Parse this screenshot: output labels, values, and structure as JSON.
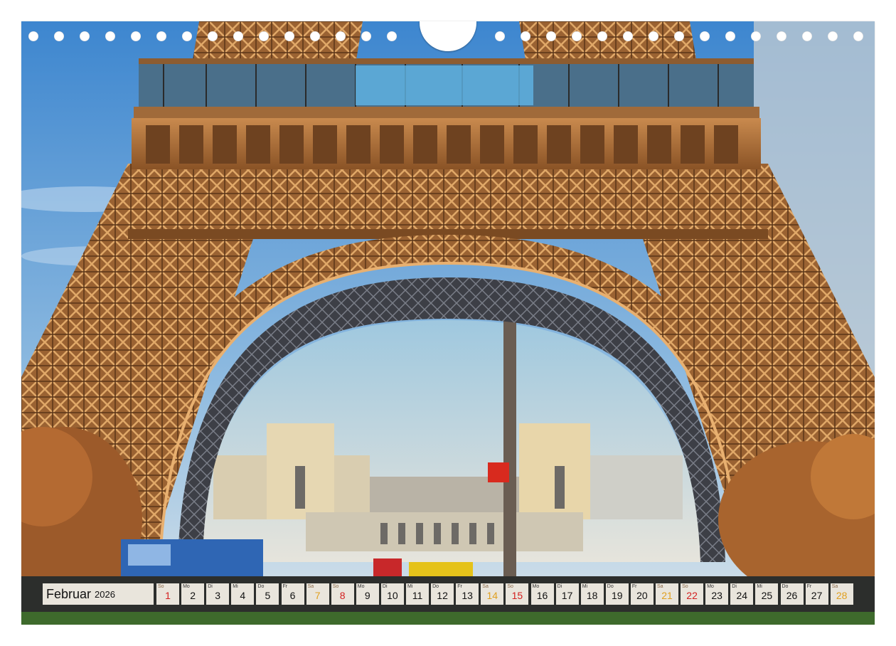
{
  "calendar": {
    "month": "Februar",
    "year": "2026",
    "days": [
      {
        "dow": "So",
        "num": "1",
        "type": "sun"
      },
      {
        "dow": "Mo",
        "num": "2",
        "type": "wd"
      },
      {
        "dow": "Di",
        "num": "3",
        "type": "wd"
      },
      {
        "dow": "Mi",
        "num": "4",
        "type": "wd"
      },
      {
        "dow": "Do",
        "num": "5",
        "type": "wd"
      },
      {
        "dow": "Fr",
        "num": "6",
        "type": "wd"
      },
      {
        "dow": "Sa",
        "num": "7",
        "type": "sat"
      },
      {
        "dow": "So",
        "num": "8",
        "type": "sun"
      },
      {
        "dow": "Mo",
        "num": "9",
        "type": "wd"
      },
      {
        "dow": "Di",
        "num": "10",
        "type": "wd"
      },
      {
        "dow": "Mi",
        "num": "11",
        "type": "wd"
      },
      {
        "dow": "Do",
        "num": "12",
        "type": "wd"
      },
      {
        "dow": "Fr",
        "num": "13",
        "type": "wd"
      },
      {
        "dow": "Sa",
        "num": "14",
        "type": "sat"
      },
      {
        "dow": "So",
        "num": "15",
        "type": "sun"
      },
      {
        "dow": "Mo",
        "num": "16",
        "type": "wd"
      },
      {
        "dow": "Di",
        "num": "17",
        "type": "wd"
      },
      {
        "dow": "Mi",
        "num": "18",
        "type": "wd"
      },
      {
        "dow": "Do",
        "num": "19",
        "type": "wd"
      },
      {
        "dow": "Fr",
        "num": "20",
        "type": "wd"
      },
      {
        "dow": "Sa",
        "num": "21",
        "type": "sat"
      },
      {
        "dow": "So",
        "num": "22",
        "type": "sun"
      },
      {
        "dow": "Mo",
        "num": "23",
        "type": "wd"
      },
      {
        "dow": "Di",
        "num": "24",
        "type": "wd"
      },
      {
        "dow": "Mi",
        "num": "25",
        "type": "wd"
      },
      {
        "dow": "Do",
        "num": "26",
        "type": "wd"
      },
      {
        "dow": "Fr",
        "num": "27",
        "type": "wd"
      },
      {
        "dow": "Sa",
        "num": "28",
        "type": "sat"
      }
    ]
  },
  "colors": {
    "sky": "#6fa3d6",
    "iron": "#b87a42",
    "saturday": "#e0a020",
    "sunday": "#d32020"
  }
}
